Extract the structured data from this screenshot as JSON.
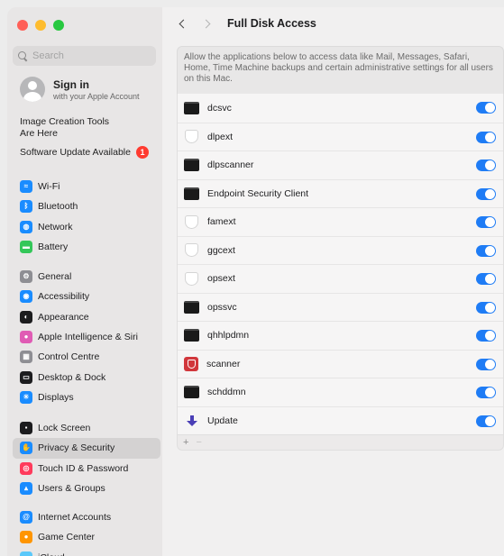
{
  "sidebar": {
    "search_placeholder": "Search",
    "signin": {
      "title": "Sign in",
      "subtitle": "with your Apple Account"
    },
    "promo": {
      "line1": "Image Creation Tools",
      "line2": "Are Here"
    },
    "update": {
      "label": "Software Update Available",
      "badge": "1"
    },
    "groups": [
      [
        {
          "label": "Wi-Fi",
          "icon": "wifi-icon",
          "color": "#1a8cff"
        },
        {
          "label": "Bluetooth",
          "icon": "bluetooth-icon",
          "color": "#1a8cff"
        },
        {
          "label": "Network",
          "icon": "globe-icon",
          "color": "#1a8cff"
        },
        {
          "label": "Battery",
          "icon": "battery-icon",
          "color": "#34c759"
        }
      ],
      [
        {
          "label": "General",
          "icon": "gear-icon",
          "color": "#8e8e93"
        },
        {
          "label": "Accessibility",
          "icon": "accessibility-icon",
          "color": "#1a8cff"
        },
        {
          "label": "Appearance",
          "icon": "appearance-icon",
          "color": "#1c1c1e"
        },
        {
          "label": "Apple Intelligence & Siri",
          "icon": "siri-icon",
          "color": "#e05bb4"
        },
        {
          "label": "Control Centre",
          "icon": "control-centre-icon",
          "color": "#8e8e93"
        },
        {
          "label": "Desktop & Dock",
          "icon": "dock-icon",
          "color": "#1c1c1e"
        },
        {
          "label": "Displays",
          "icon": "sun-icon",
          "color": "#1a8cff"
        }
      ],
      [
        {
          "label": "Lock Screen",
          "icon": "lock-icon",
          "color": "#1c1c1e"
        },
        {
          "label": "Privacy & Security",
          "icon": "hand-icon",
          "color": "#1a8cff",
          "selected": true
        },
        {
          "label": "Touch ID & Password",
          "icon": "fingerprint-icon",
          "color": "#ff3b5c"
        },
        {
          "label": "Users & Groups",
          "icon": "users-icon",
          "color": "#1a8cff"
        }
      ],
      [
        {
          "label": "Internet Accounts",
          "icon": "at-icon",
          "color": "#1a8cff"
        },
        {
          "label": "Game Center",
          "icon": "game-center-icon",
          "color": "#ff9500"
        },
        {
          "label": "iCloud",
          "icon": "cloud-icon",
          "color": "#5ac8fa"
        }
      ]
    ]
  },
  "header": {
    "title": "Full Disk Access"
  },
  "description": "Allow the applications below to access data like Mail, Messages, Safari, Home, Time Machine backups and certain administrative settings for all users on this Mac.",
  "apps": [
    {
      "name": "dcsvc",
      "icon": "terminal",
      "enabled": true
    },
    {
      "name": "dlpext",
      "icon": "shield",
      "enabled": true
    },
    {
      "name": "dlpscanner",
      "icon": "terminal",
      "enabled": true
    },
    {
      "name": "Endpoint Security Client",
      "icon": "terminal",
      "enabled": true
    },
    {
      "name": "famext",
      "icon": "shield",
      "enabled": true
    },
    {
      "name": "ggcext",
      "icon": "shield",
      "enabled": true
    },
    {
      "name": "opsext",
      "icon": "shield",
      "enabled": true
    },
    {
      "name": "opssvc",
      "icon": "terminal",
      "enabled": true
    },
    {
      "name": "qhhlpdmn",
      "icon": "terminal",
      "enabled": true
    },
    {
      "name": "scanner",
      "icon": "scanner",
      "enabled": true
    },
    {
      "name": "schddmn",
      "icon": "terminal",
      "enabled": true
    },
    {
      "name": "Update",
      "icon": "arrow",
      "enabled": true
    }
  ],
  "footer": {
    "add": "+",
    "remove": "−"
  },
  "colors": {
    "accent": "#1f7cf5",
    "sidebar_selected": "#d4d2d2"
  }
}
